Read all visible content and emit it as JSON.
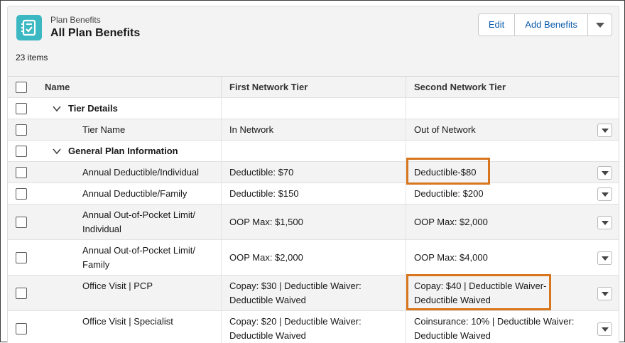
{
  "header": {
    "object_label": "Plan Benefits",
    "title": "All Plan Benefits",
    "icon": "checklist-icon",
    "icon_color": "#3bb8c2",
    "buttons": {
      "edit": "Edit",
      "add": "Add Benefits"
    }
  },
  "item_count": "23 items",
  "columns": {
    "name": "Name",
    "first": "First Network Tier",
    "second": "Second Network Tier"
  },
  "rows": [
    {
      "type": "group",
      "name": "Tier Details"
    },
    {
      "type": "item",
      "name_lines": [
        "Tier Name"
      ],
      "first_lines": [
        "In Network"
      ],
      "second_lines": [
        "Out of Network"
      ]
    },
    {
      "type": "group",
      "name": "General Plan Information"
    },
    {
      "type": "item",
      "name_lines": [
        "Annual Deductible/Individual"
      ],
      "first_lines": [
        "Deductible: $70"
      ],
      "second_lines": [
        "Deductible-$80"
      ],
      "highlighted": true
    },
    {
      "type": "item",
      "name_lines": [
        "Annual Deductible/Family"
      ],
      "first_lines": [
        "Deductible: $150"
      ],
      "second_lines": [
        "Deductible: $200"
      ]
    },
    {
      "type": "item",
      "name_lines": [
        "Annual Out-of-Pocket Limit/",
        "Individual"
      ],
      "first_lines": [
        "OOP Max: $1,500"
      ],
      "second_lines": [
        "OOP Max: $2,000"
      ]
    },
    {
      "type": "item",
      "name_lines": [
        "Annual Out-of-Pocket Limit/",
        "Family"
      ],
      "first_lines": [
        "OOP Max: $2,000"
      ],
      "second_lines": [
        "OOP Max: $4,000"
      ]
    },
    {
      "type": "item",
      "name_lines": [
        "Office Visit | PCP",
        ""
      ],
      "first_lines": [
        "Copay: $30 | Deductible Waiver:",
        "Deductible Waived"
      ],
      "second_lines": [
        "Copay: $40 | Deductible Waiver-",
        "Deductible Waived"
      ],
      "highlighted": true
    },
    {
      "type": "item",
      "name_lines": [
        "Office Visit | Specialist",
        ""
      ],
      "first_lines": [
        "Copay: $20 | Deductible Waiver:",
        "Deductible Waived"
      ],
      "second_lines": [
        "Coinsurance: 10% | Deductible Waiver:",
        "Deductible Waived"
      ]
    }
  ],
  "colors": {
    "highlight": "#d8761e",
    "link": "#0b5cab"
  }
}
